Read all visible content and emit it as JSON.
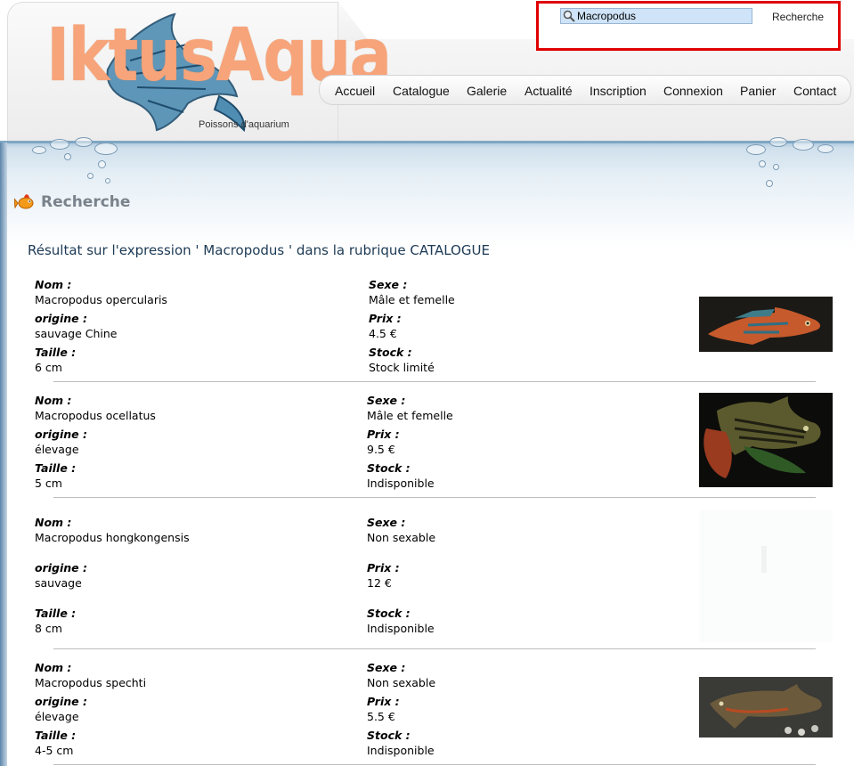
{
  "site": {
    "logo_text": "IktusAqua",
    "tagline": "Poissons d'aquarium"
  },
  "search": {
    "value": "Macropodus",
    "button_label": "Recherche"
  },
  "nav": {
    "items": [
      {
        "label": "Accueil"
      },
      {
        "label": "Catalogue"
      },
      {
        "label": "Galerie"
      },
      {
        "label": "Actualité"
      },
      {
        "label": "Inscription"
      },
      {
        "label": "Connexion"
      },
      {
        "label": "Panier"
      },
      {
        "label": "Contact"
      }
    ]
  },
  "page": {
    "title": "Recherche",
    "result_heading": "Résultat sur l'expression ' Macropodus ' dans la rubrique CATALOGUE"
  },
  "labels": {
    "nom": "Nom :",
    "origine": "origine :",
    "taille": "Taille :",
    "sexe": "Sexe :",
    "prix": "Prix :",
    "stock": "Stock :"
  },
  "results": [
    {
      "nom": "Macropodus opercularis",
      "origine": "sauvage Chine",
      "taille": "6 cm",
      "sexe": "Mâle et femelle",
      "prix": "4.5 €",
      "stock": "Stock limité",
      "image": "macropodus-opercularis-photo"
    },
    {
      "nom": "Macropodus ocellatus",
      "origine": "élevage",
      "taille": "5 cm",
      "sexe": "Mâle et femelle",
      "prix": "9.5 €",
      "stock": "Indisponible",
      "image": "macropodus-ocellatus-photo"
    },
    {
      "nom": "Macropodus hongkongensis",
      "origine": "sauvage",
      "taille": "8 cm",
      "sexe": "Non sexable",
      "prix": "12 €",
      "stock": "Indisponible",
      "image": "macropodus-hongkongensis-photo"
    },
    {
      "nom": "Macropodus spechti",
      "origine": "élevage",
      "taille": "4-5 cm",
      "sexe": "Non sexable",
      "prix": "5.5 €",
      "stock": "Indisponible",
      "image": "macropodus-spechti-photo"
    }
  ]
}
